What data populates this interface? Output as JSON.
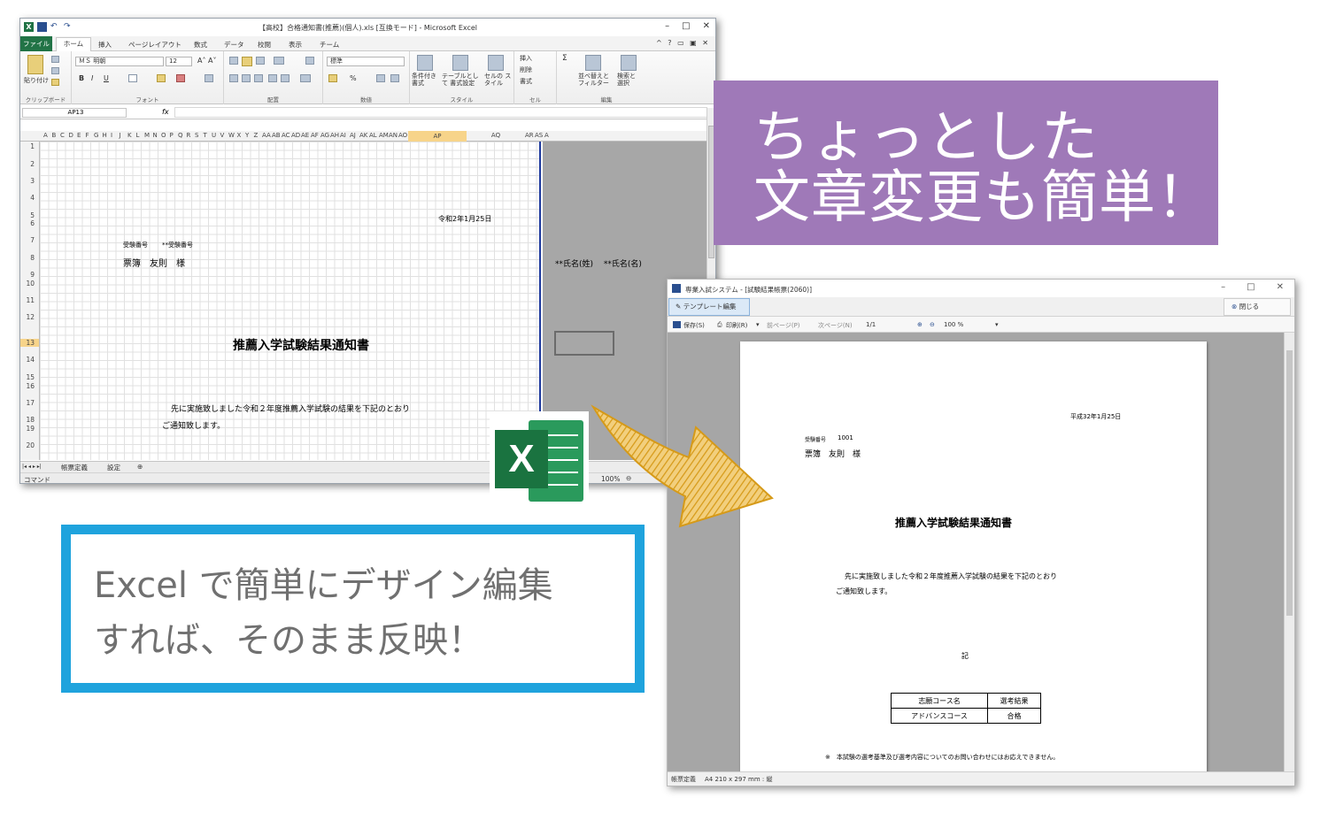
{
  "excel": {
    "title": "【高校】合格通知書(推薦)(個人).xls [互換モード] - Microsoft Excel",
    "tabs": {
      "file": "ファイル",
      "home": "ホーム",
      "insert": "挿入",
      "page_layout": "ページレイアウト",
      "formulas": "数式",
      "data": "データ",
      "review": "校閲",
      "view": "表示",
      "team": "チーム"
    },
    "ribbon": {
      "paste": "貼り付け",
      "font_name": "ＭＳ 明朝",
      "font_size": "12",
      "bold": "B",
      "italic": "I",
      "underline": "U",
      "number_format": "標準",
      "percent": "%",
      "cond_format": "条件付き 書式",
      "table_format": "テーブルとして 書式設定",
      "cell_style": "セルの スタイル",
      "insert": "挿入",
      "delete": "削除",
      "format": "書式",
      "sum": "Σ",
      "sort": "並べ替えと フィルター",
      "find": "検索と 選択",
      "groups": {
        "clipboard": "クリップボード",
        "font": "フォント",
        "alignment": "配置",
        "number": "数値",
        "style": "スタイル",
        "cells": "セル",
        "editing": "編集"
      }
    },
    "name_box": "AP13",
    "fx": "fx",
    "columns": [
      "A",
      "B",
      "C",
      "D",
      "E",
      "F",
      "G",
      "H",
      "I",
      "J",
      "K",
      "L",
      "M",
      "N",
      "O",
      "P",
      "Q",
      "R",
      "S",
      "T",
      "U",
      "V",
      "W",
      "X",
      "Y",
      "Z",
      "AA",
      "AB",
      "AC",
      "AD",
      "AE",
      "AF",
      "AG",
      "AH",
      "AI",
      "AJ",
      "AK",
      "AL",
      "AM",
      "AN",
      "AO",
      "AP",
      "AQ",
      "AR",
      "AS",
      "A"
    ],
    "rows": [
      "1",
      "2",
      "3",
      "4",
      "5",
      "6",
      "7",
      "8",
      "9",
      "10",
      "11",
      "12",
      "13",
      "14",
      "15",
      "16",
      "17",
      "18",
      "19",
      "20"
    ],
    "cells": {
      "date": "令和2年1月25日",
      "exam_no_label": "受験番号",
      "exam_no_value": "**受験番号",
      "name": "票簿　友則　様",
      "name_fields": "**氏名(姓)　 **氏名(名)",
      "heading": "推薦入学試験結果通知書",
      "body1": "先に実施致しました令和２年度推薦入学試験の結果を下記のとおり",
      "body2": "ご通知致します。"
    },
    "sheet_tabs": [
      "帳票定義",
      "設定"
    ],
    "status": {
      "mode": "コマンド",
      "zoom": "100%"
    }
  },
  "callout_purple": {
    "line1": "ちょっとした",
    "line2": "文章変更も簡単！"
  },
  "callout_blue": {
    "line1": "Excel で簡単にデザイン編集",
    "line2": "すれば、そのまま反映！"
  },
  "excel_logo": {
    "letter": "X"
  },
  "system": {
    "title": "専業入試システム - [試験結果帳票(2060)]",
    "template_edit": "テンプレート編集",
    "close": "閉じる",
    "toolbar": {
      "save": "保存(S)",
      "print": "印刷(R)",
      "prev": "前ページ(P)",
      "next": "次ページ(N)",
      "page": "1/1",
      "zoom": "100 %"
    },
    "doc": {
      "date": "平成32年1月25日",
      "exam_no_label": "受験番号",
      "exam_no_value": "1001",
      "name": "票簿　友則　様",
      "heading": "推薦入学試験結果通知書",
      "body1": "先に実施致しました令和２年度推薦入学試験の結果を下記のとおり",
      "body2": "ご通知致します。",
      "ki": "記",
      "table": {
        "h1": "志願コース名",
        "h2": "選考結果",
        "v1": "アドバンスコース",
        "v2": "合格"
      },
      "note": "※　本試験の選考基準及び選考内容についてのお問い合わせにはお応えできません。"
    },
    "status": {
      "label": "帳票定義",
      "paper": "A4 210 x 297 mm : 縦"
    }
  },
  "colors": {
    "purple": "#9f79b8",
    "blue_border": "#1fa3dd",
    "excel_green": "#217346",
    "arrow": "#e0a82e"
  }
}
